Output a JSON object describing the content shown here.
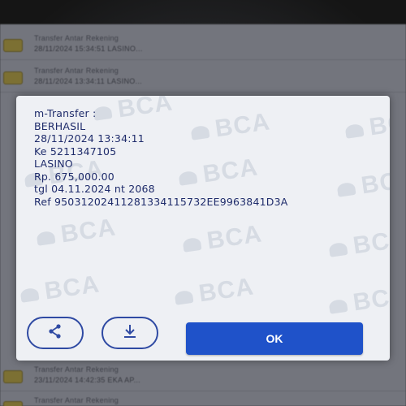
{
  "history_list": {
    "rows": [
      {
        "title": "Transfer Antar Rekening",
        "sub": "28/11/2024 15:34:51 LASINO..."
      },
      {
        "title": "Transfer Antar Rekening",
        "sub": "28/11/2024 13:34:11 LASINO..."
      },
      {
        "title": "Transfer Antar Rekening",
        "sub": "23/11/2024 14:42:35 EKA AP..."
      },
      {
        "title": "Transfer Antar Rekening",
        "sub": ""
      }
    ]
  },
  "dialog": {
    "watermark": "BCA",
    "receipt_lines": [
      "m-Transfer :",
      "BERHASIL",
      "28/11/2024 13:34:11",
      "Ke 5211347105",
      "LASINO",
      "Rp. 675,000.00",
      "tgl 04.11.2024 nt 2068",
      "Ref 95031202411281334115732EE9963841D3A"
    ],
    "ok_label": "OK",
    "share_icon": "share-icon",
    "download_icon": "download-icon"
  },
  "colors": {
    "ok_button": "#1f52c9",
    "receipt_text": "#1f2c6b",
    "dialog_bg": "#eef0f4",
    "circle_button_border": "#2f4aa3"
  }
}
